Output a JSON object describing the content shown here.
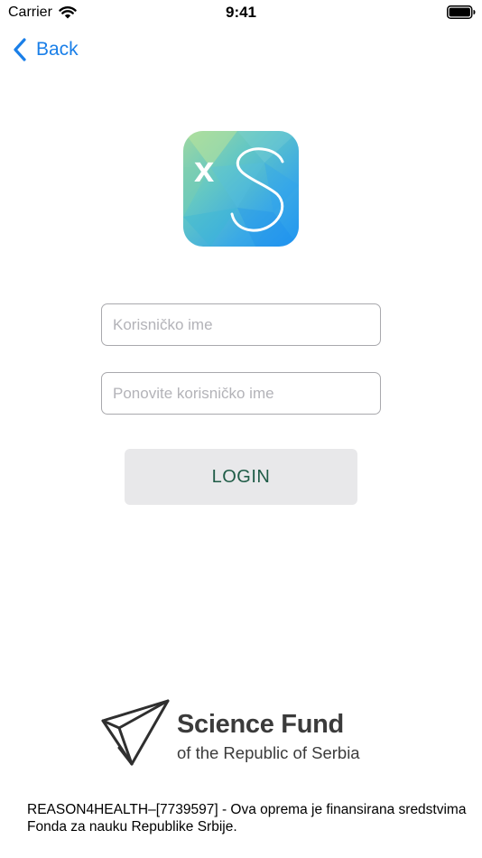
{
  "status_bar": {
    "carrier": "Carrier",
    "time": "9:41"
  },
  "nav": {
    "back_label": "Back"
  },
  "logo": {
    "icon": "xs-app-logo",
    "text": "xS"
  },
  "form": {
    "username_placeholder": "Korisničko ime",
    "username_value": "",
    "repeat_placeholder": "Ponovite korisničko ime",
    "repeat_value": "",
    "login_label": "LOGIN"
  },
  "fund": {
    "icon": "paper-plane-icon",
    "title": "Science Fund",
    "subtitle": "of the Republic of Serbia"
  },
  "footer": {
    "note": "REASON4HEALTH–[7739597] - Ova oprema je finansirana sredstvima Fonda za nauku Republike Srbije."
  },
  "colors": {
    "accent": "#1a7fe8",
    "login_text": "#1f5c47",
    "login_bg": "#e8e8ea",
    "fund_text": "#3b3b3b"
  }
}
